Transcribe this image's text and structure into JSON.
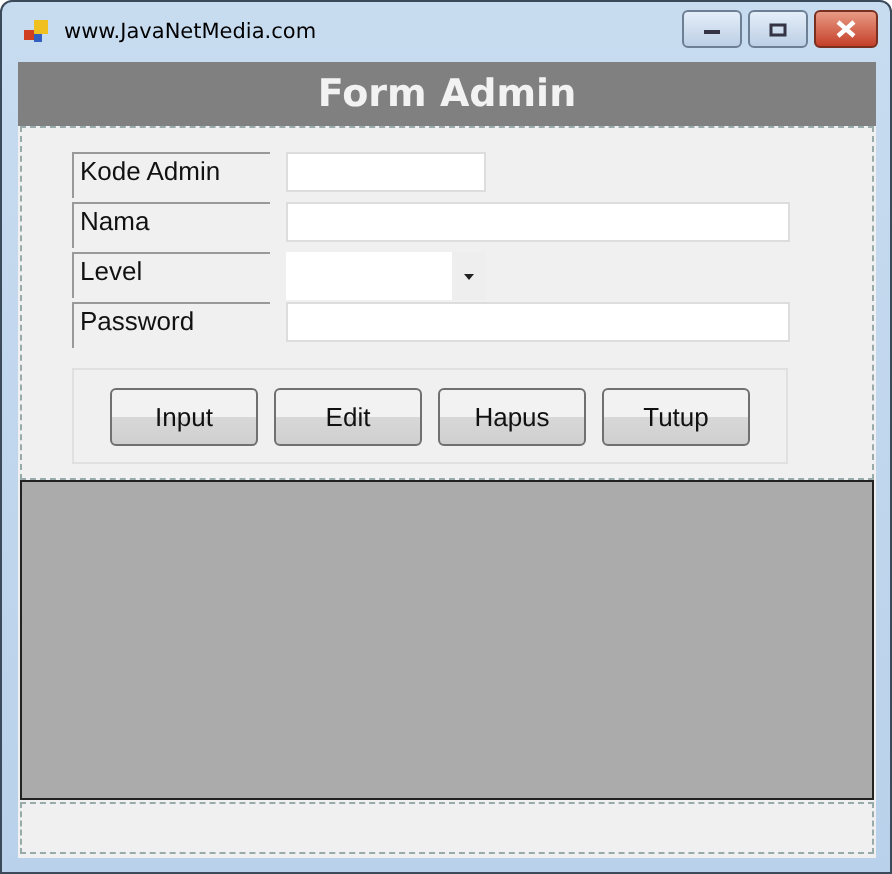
{
  "window": {
    "title": "www.JavaNetMedia.com"
  },
  "header": {
    "title": "Form Admin"
  },
  "fields": [
    {
      "label": "Kode Admin",
      "kind": "short"
    },
    {
      "label": "Nama",
      "kind": "text"
    },
    {
      "label": "Level",
      "kind": "combo"
    },
    {
      "label": "Password",
      "kind": "text"
    }
  ],
  "buttons": [
    "Input",
    "Edit",
    "Hapus",
    "Tutup"
  ]
}
